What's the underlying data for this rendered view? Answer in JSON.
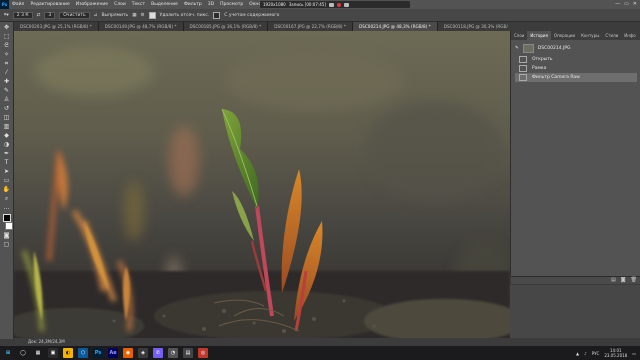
{
  "menu": {
    "logo": "Ps",
    "items": [
      "Файл",
      "Редактирование",
      "Изображение",
      "Слои",
      "Текст",
      "Выделение",
      "Фильтр",
      "3D",
      "Просмотр",
      "Окно",
      "Справка"
    ]
  },
  "recorder": {
    "resolution": "1920x1080",
    "label": "Запись [00:07:45]"
  },
  "window_controls": {
    "min": "—",
    "max": "▭",
    "close": "✕"
  },
  "options": {
    "size": "2 3 К",
    "value": "3",
    "clear": "Очистить",
    "straighten": "Выпрямить",
    "delete_cropped": "Удалить отсеч. пикс.",
    "content_aware": "С учетом содержимого"
  },
  "tabs": [
    {
      "label": "DSC00203.JPG @ 25,1% (RGB/8) *",
      "active": false
    },
    {
      "label": "DSC00149.JPG @ 48,7% (RGB/8) *",
      "active": false
    },
    {
      "label": "DSC00185.JPG @ 36,1% (RGB/8) *",
      "active": false
    },
    {
      "label": "DSC00167.JPG @ 22,7% (RGB/8) *",
      "active": false
    },
    {
      "label": "DSC00214.JPG @ 48,3% (RGB/8) *",
      "active": true
    },
    {
      "label": "DSC00118.JPG @ 30,3% (RGB/8) *",
      "active": false
    }
  ],
  "panel": {
    "tabs": [
      "Слои",
      "История",
      "Операции",
      "Контуры",
      "Стили",
      "Инфо"
    ],
    "active_tab": "История",
    "snapshot": "DSC00214.JPG",
    "history": [
      {
        "label": "Открыть",
        "selected": false
      },
      {
        "label": "Рамка",
        "selected": false
      },
      {
        "label": "Фильтр Camera Raw",
        "selected": true
      }
    ]
  },
  "status": "Док: 24,3М/24,3М",
  "taskbar": {
    "apps": [
      "⊞",
      "◯",
      "▦",
      "▣",
      "◐",
      "⬡",
      "Ps",
      "Ae",
      "◉",
      "◈",
      "✆",
      "◔",
      "▤",
      "◎"
    ],
    "time": "14:01",
    "date": "23.05.2018",
    "lang": "РУС"
  },
  "colors": {
    "accent_ps": "#31a8ff",
    "record": "#e0383e"
  }
}
